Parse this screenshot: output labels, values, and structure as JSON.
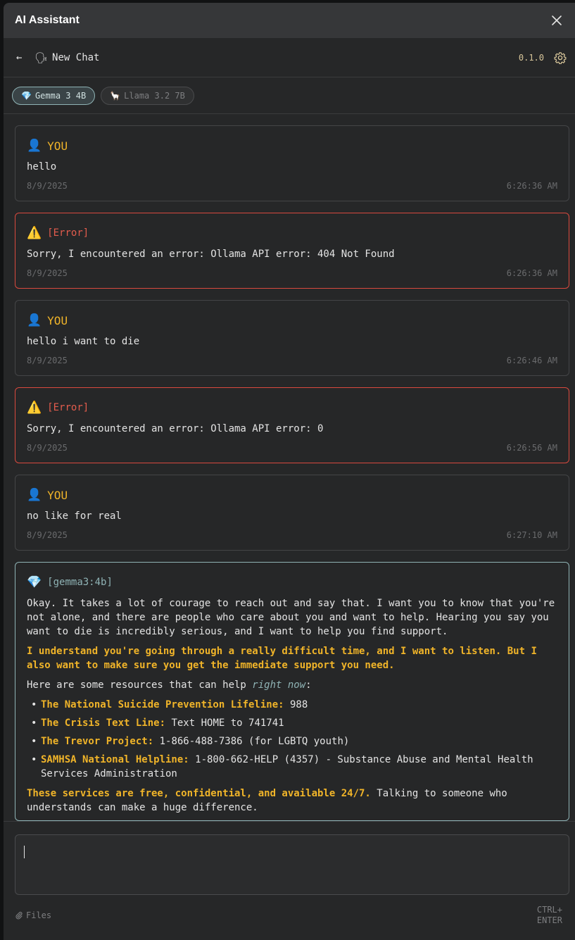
{
  "window": {
    "title": "AI Assistant"
  },
  "header": {
    "back_icon": "←",
    "chat_emoji": "🗣",
    "chat_title": "New Chat",
    "version": "0.1.0"
  },
  "models": [
    {
      "icon": "💎",
      "label": "Gemma 3 4B",
      "active": true
    },
    {
      "icon": "🦙",
      "label": "Llama 3.2 7B",
      "active": false
    }
  ],
  "messages": [
    {
      "type": "user",
      "icon": "👤",
      "label": "YOU",
      "text": "hello",
      "date": "8/9/2025",
      "time": "6:26:36 AM"
    },
    {
      "type": "error",
      "icon": "⚠️",
      "label": "[Error]",
      "text": "Sorry, I encountered an error: Ollama API error: 404 Not Found",
      "date": "8/9/2025",
      "time": "6:26:36 AM"
    },
    {
      "type": "user",
      "icon": "👤",
      "label": "YOU",
      "text": "hello i want to die",
      "date": "8/9/2025",
      "time": "6:26:46 AM"
    },
    {
      "type": "error",
      "icon": "⚠️",
      "label": "[Error]",
      "text": "Sorry, I encountered an error: Ollama API error: 0",
      "date": "8/9/2025",
      "time": "6:26:56 AM"
    },
    {
      "type": "user",
      "icon": "👤",
      "label": "YOU",
      "text": "no like for real",
      "date": "8/9/2025",
      "time": "6:27:10 AM"
    }
  ],
  "ai_message": {
    "icon": "💎",
    "label": "[gemma3:4b]",
    "p1": "Okay. It takes a lot of courage to reach out and say that. I want you to know that you're not alone, and there are people who care about you and want to help. Hearing you say you want to die is incredibly serious, and I want to help you find support.",
    "p2": "I understand you're going through a really difficult time, and I want to listen. But I also want to make sure you get the immediate support you need.",
    "p3_before": "Here are some resources that can help ",
    "p3_em": "right now",
    "p3_after": ":",
    "resources": [
      {
        "name": "The National Suicide Prevention Lifeline:",
        "detail": " 988"
      },
      {
        "name": "The Crisis Text Line:",
        "detail": " Text HOME to 741741"
      },
      {
        "name": "The Trevor Project:",
        "detail": " 1-866-488-7386 (for LGBTQ youth)"
      },
      {
        "name": "SAMHSA National Helpline:",
        "detail": " 1-800-662-HELP (4357) - Substance Abuse and Mental Health Services Administration"
      }
    ],
    "p4_strong": "These services are free, confidential, and available 24/7.",
    "p4_rest": " Talking to someone who understands can make a huge difference."
  },
  "composer": {
    "value": "",
    "files_label": "Files",
    "hint_line1": "CTRL+",
    "hint_line2": "ENTER"
  }
}
